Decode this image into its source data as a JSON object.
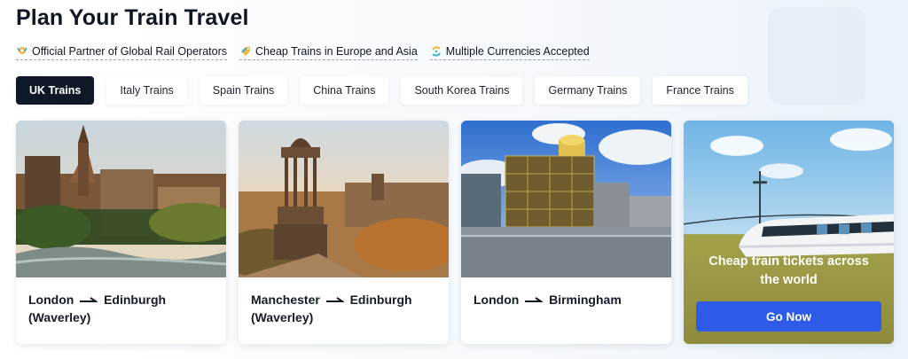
{
  "page": {
    "title": "Plan Your Train Travel"
  },
  "features": [
    {
      "label": "Official Partner of Global Rail Operators",
      "icon": "partner-badge-icon"
    },
    {
      "label": "Cheap Trains in Europe and Asia",
      "icon": "price-tag-icon"
    },
    {
      "label": "Multiple Currencies Accepted",
      "icon": "currency-exchange-icon"
    }
  ],
  "tabs": [
    {
      "label": "UK Trains",
      "active": true
    },
    {
      "label": "Italy Trains",
      "active": false
    },
    {
      "label": "Spain Trains",
      "active": false
    },
    {
      "label": "China Trains",
      "active": false
    },
    {
      "label": "South Korea Trains",
      "active": false
    },
    {
      "label": "Germany Trains",
      "active": false
    },
    {
      "label": "France Trains",
      "active": false
    }
  ],
  "routes": [
    {
      "from": "London",
      "to": "Edinburgh (Waverley)",
      "image": "edinburgh-castle-photo"
    },
    {
      "from": "Manchester",
      "to": "Edinburgh (Waverley)",
      "image": "calton-hill-monument-photo"
    },
    {
      "from": "London",
      "to": "Birmingham",
      "image": "birmingham-library-photo"
    }
  ],
  "promo": {
    "text": "Cheap train tickets across the world",
    "button_label": "Go Now",
    "image": "high-speed-train-photo"
  },
  "colors": {
    "active_tab": "#0f1826",
    "button": "#2d5be8",
    "promo_bg": "#9b9640"
  }
}
